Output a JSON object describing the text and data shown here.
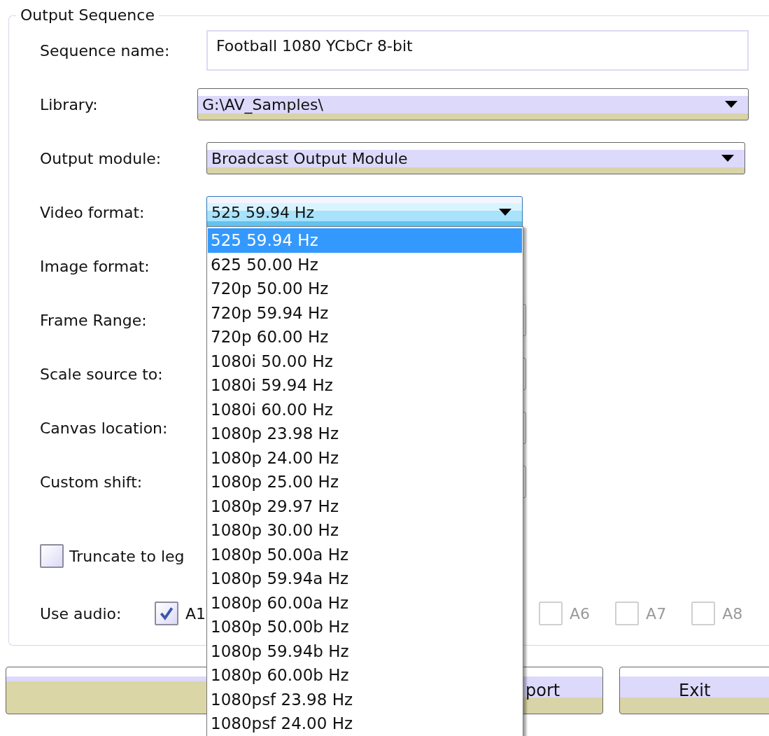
{
  "group": {
    "title": "Output Sequence"
  },
  "fields": [
    {
      "label": "Sequence name:",
      "kind": "text",
      "value": "Football 1080 YCbCr 8-bit"
    },
    {
      "label": "Library:",
      "kind": "combo",
      "value": "G:\\AV_Samples\\"
    },
    {
      "label": "Output module:",
      "kind": "combo",
      "value": "Broadcast Output Module"
    },
    {
      "label": "Video format:",
      "kind": "open",
      "value": "525 59.94 Hz"
    },
    {
      "label": "Image format:",
      "kind": "covered"
    },
    {
      "label": "Frame Range:",
      "kind": "edge"
    },
    {
      "label": "Scale source to:",
      "kind": "edge"
    },
    {
      "label": "Canvas location:",
      "kind": "edge"
    },
    {
      "label": "Custom shift:",
      "kind": "edge"
    }
  ],
  "truncate": {
    "label": "Truncate to leg",
    "checked": false
  },
  "audio": {
    "label": "Use audio:",
    "tracks": [
      {
        "label": "A1",
        "checked": true,
        "disabled": false
      },
      {
        "label": "A6",
        "checked": false,
        "disabled": true
      },
      {
        "label": "A7",
        "checked": false,
        "disabled": true
      },
      {
        "label": "A8",
        "checked": false,
        "disabled": true
      }
    ]
  },
  "dropdown": {
    "options": [
      {
        "label": "525 59.94 Hz",
        "selected": true
      },
      {
        "label": "625 50.00 Hz",
        "selected": false
      },
      {
        "label": "720p 50.00 Hz",
        "selected": false
      },
      {
        "label": "720p 59.94 Hz",
        "selected": false
      },
      {
        "label": "720p 60.00 Hz",
        "selected": false
      },
      {
        "label": "1080i 50.00 Hz",
        "selected": false
      },
      {
        "label": "1080i 59.94 Hz",
        "selected": false
      },
      {
        "label": "1080i 60.00 Hz",
        "selected": false
      },
      {
        "label": "1080p 23.98 Hz",
        "selected": false
      },
      {
        "label": "1080p 24.00 Hz",
        "selected": false
      },
      {
        "label": "1080p 25.00 Hz",
        "selected": false
      },
      {
        "label": "1080p 29.97 Hz",
        "selected": false
      },
      {
        "label": "1080p 30.00 Hz",
        "selected": false
      },
      {
        "label": "1080p 50.00a Hz",
        "selected": false
      },
      {
        "label": "1080p 59.94a Hz",
        "selected": false
      },
      {
        "label": "1080p 60.00a Hz",
        "selected": false
      },
      {
        "label": "1080p 50.00b Hz",
        "selected": false
      },
      {
        "label": "1080p 59.94b Hz",
        "selected": false
      },
      {
        "label": "1080p 60.00b Hz",
        "selected": false
      },
      {
        "label": "1080psf 23.98 Hz",
        "selected": false
      },
      {
        "label": "1080psf 24.00 Hz",
        "selected": false
      }
    ]
  },
  "buttons": [
    {
      "label": "port"
    },
    {
      "label": "Exit"
    }
  ]
}
